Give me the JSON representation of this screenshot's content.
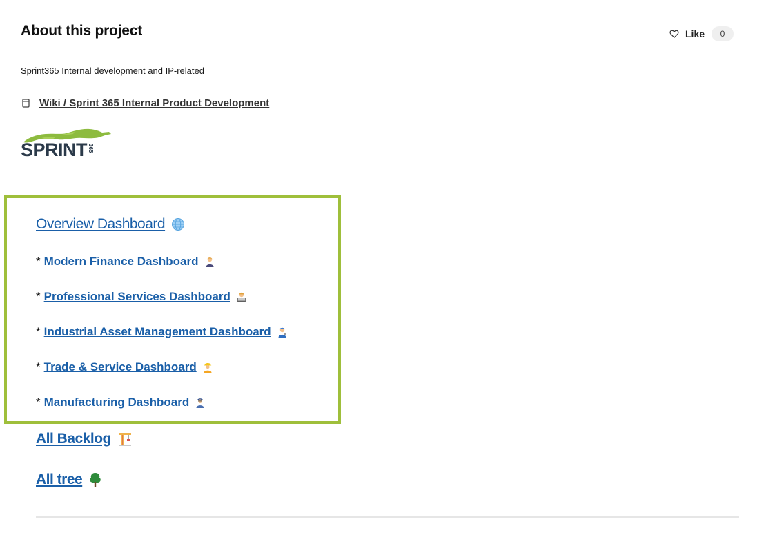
{
  "header": {
    "title": "About this project",
    "like_label": "Like",
    "like_count": "0"
  },
  "project": {
    "description": "Sprint365 Internal development and IP-related",
    "wiki_link": "Wiki / Sprint 365 Internal Product Development",
    "logo_text": "SPRINT",
    "logo_superscript": "365"
  },
  "dashboards": {
    "overview": "Overview Dashboard",
    "items": [
      {
        "bullet": "*",
        "label": "Modern Finance Dashboard",
        "icon": "businessperson-emoji"
      },
      {
        "bullet": "*",
        "label": "Professional Services Dashboard",
        "icon": "technologist-emoji"
      },
      {
        "bullet": "*",
        "label": "Industrial Asset Management Dashboard",
        "icon": "mechanic-emoji"
      },
      {
        "bullet": "*",
        "label": "Trade & Service Dashboard",
        "icon": "construction-worker-emoji"
      },
      {
        "bullet": "*",
        "label": "Manufacturing Dashboard",
        "icon": "factory-worker-emoji"
      }
    ]
  },
  "links": {
    "all_backlog": "All Backlog",
    "all_tree": "All tree"
  },
  "colors": {
    "link": "#1a5fa8",
    "highlight_border": "#9fbf3b",
    "logo_green": "#8dbb3f",
    "logo_text": "#2b3a4a"
  }
}
